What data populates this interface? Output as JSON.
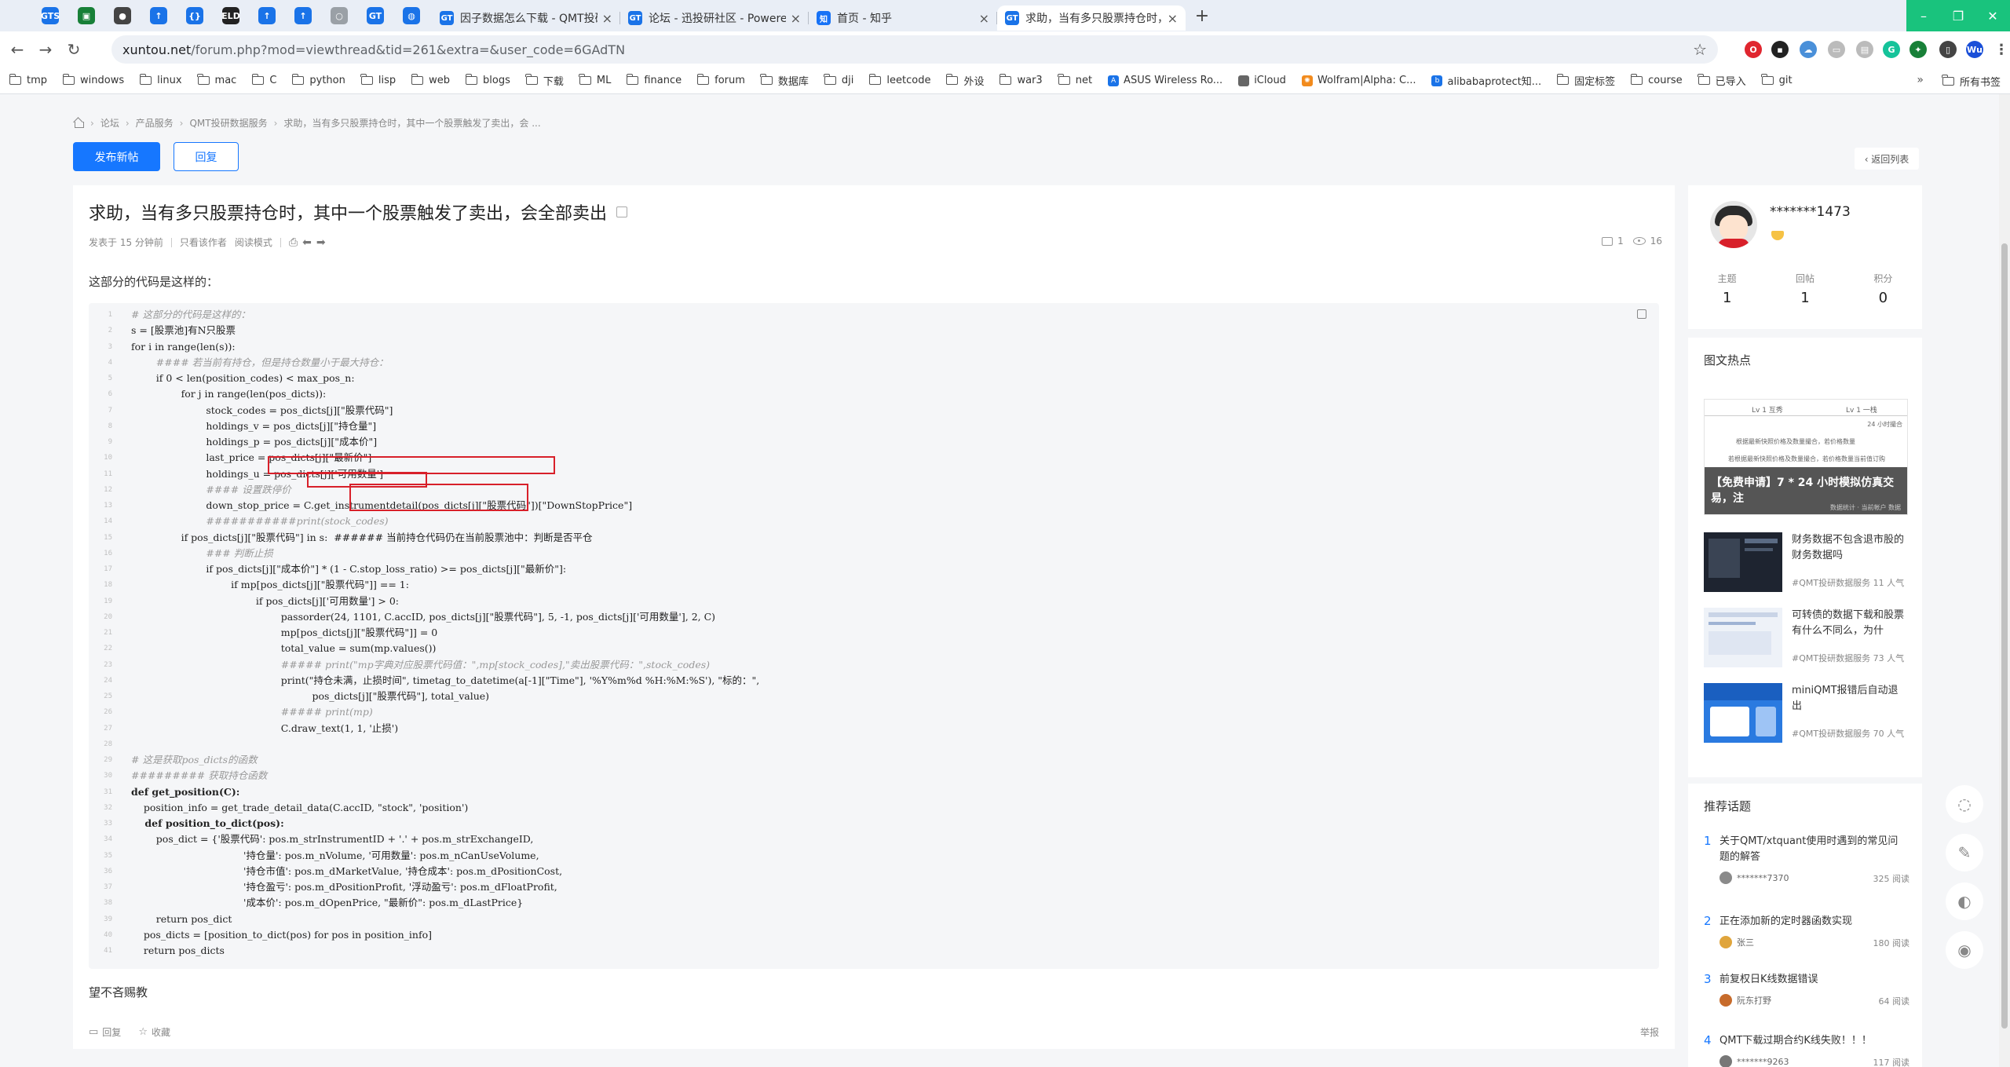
{
  "browser": {
    "pinned_tabs": [
      {
        "icon": "gstatic-icon",
        "label": "GTS",
        "color": "#1a73e8"
      },
      {
        "icon": "image-icon",
        "label": "▣",
        "color": "#188038"
      },
      {
        "icon": "github-icon",
        "label": "●",
        "color": "#444444"
      },
      {
        "icon": "arrow-up-icon",
        "label": "↑",
        "color": "#1a73e8"
      },
      {
        "icon": "bracket-icon",
        "label": "{}",
        "color": "#1a73e8"
      },
      {
        "icon": "eld-icon",
        "label": "ELD",
        "color": "#222222"
      },
      {
        "icon": "arrow-up-icon",
        "label": "↑",
        "color": "#1a73e8"
      },
      {
        "icon": "arrow-up-icon",
        "label": "↑",
        "color": "#1a73e8"
      },
      {
        "icon": "loading-icon",
        "label": "○",
        "color": "#9aa0a6"
      },
      {
        "icon": "gt-icon",
        "label": "GT",
        "color": "#1a73e8"
      },
      {
        "icon": "chat-icon",
        "label": "◍",
        "color": "#1a73e8"
      }
    ],
    "tabs": [
      {
        "title": "因子数据怎么下载 - QMT投研",
        "fav": "GT",
        "fav_color": "#1a73e8",
        "close": "×"
      },
      {
        "title": "论坛 - 迅投研社区 - Powered",
        "fav": "GT",
        "fav_color": "#1a73e8",
        "close": "×"
      },
      {
        "title": "首页 - 知乎",
        "fav": "知",
        "fav_color": "#1772f6",
        "close": "×"
      },
      {
        "title": "求助，当有多只股票持仓时，其",
        "fav": "GT",
        "fav_color": "#1a73e8",
        "close": "×"
      }
    ],
    "new_tab": "+",
    "window_controls": [
      "–",
      "❐",
      "✕"
    ],
    "nav": {
      "back": "←",
      "forward": "→",
      "reload": "↻"
    },
    "url_host": "xuntou.net",
    "url_path": "/forum.php?mod=viewthread&tid=261&extra=&user_code=6GAdTN",
    "star": "☆",
    "extensions": [
      {
        "icon": "opera-icon",
        "label": "O",
        "color": "#e0262f"
      },
      {
        "icon": "ext-icon",
        "label": "▪",
        "color": "#222222"
      },
      {
        "icon": "cloud-icon",
        "label": "☁",
        "color": "#4a90d9"
      },
      {
        "icon": "screen-icon",
        "label": "▭",
        "color": "#bbbbbb"
      },
      {
        "icon": "reader-icon",
        "label": "▤",
        "color": "#bbbbbb"
      },
      {
        "icon": "grammarly-icon",
        "label": "G",
        "color": "#15c39a"
      },
      {
        "icon": "puzzle-icon",
        "label": "✦",
        "color": "#188038"
      },
      {
        "icon": "sidepanel-icon",
        "label": "▯",
        "color": "#444444"
      },
      {
        "icon": "profile-icon",
        "label": "Wu",
        "color": "#1a4fd8"
      },
      {
        "icon": "menu-icon",
        "label": "⋮",
        "color": "#555555"
      }
    ],
    "bookmarks": [
      {
        "label": "tmp",
        "type": "folder"
      },
      {
        "label": "windows",
        "type": "folder"
      },
      {
        "label": "linux",
        "type": "folder"
      },
      {
        "label": "mac",
        "type": "folder"
      },
      {
        "label": "C",
        "type": "folder"
      },
      {
        "label": "python",
        "type": "folder"
      },
      {
        "label": "lisp",
        "type": "folder"
      },
      {
        "label": "web",
        "type": "folder"
      },
      {
        "label": "blogs",
        "type": "folder"
      },
      {
        "label": "下载",
        "type": "folder"
      },
      {
        "label": "ML",
        "type": "folder"
      },
      {
        "label": "finance",
        "type": "folder"
      },
      {
        "label": "forum",
        "type": "folder"
      },
      {
        "label": "数据库",
        "type": "folder"
      },
      {
        "label": "dji",
        "type": "folder"
      },
      {
        "label": "leetcode",
        "type": "folder"
      },
      {
        "label": "外设",
        "type": "folder"
      },
      {
        "label": "war3",
        "type": "folder"
      },
      {
        "label": "net",
        "type": "folder"
      },
      {
        "label": "ASUS Wireless Ro...",
        "type": "site",
        "fav": "A",
        "color": "#1a73e8"
      },
      {
        "label": "iCloud",
        "type": "site",
        "fav": "",
        "color": "#666666"
      },
      {
        "label": "Wolfram|Alpha: C...",
        "type": "site",
        "fav": "✺",
        "color": "#f28b1d"
      },
      {
        "label": "alibabaprotect知...",
        "type": "site",
        "fav": "b",
        "color": "#1a73e8"
      },
      {
        "label": "固定标签",
        "type": "folder"
      },
      {
        "label": "course",
        "type": "folder"
      },
      {
        "label": "已导入",
        "type": "folder"
      },
      {
        "label": "git",
        "type": "folder"
      }
    ],
    "bookmarks_more": "»",
    "all_bookmarks": "所有书签"
  },
  "page": {
    "breadcrumb": [
      "论坛",
      "产品服务",
      "QMT投研数据服务",
      "求助，当有多只股票持仓时，其中一个股票触发了卖出，会 ..."
    ],
    "breadcrumb_sep": "›",
    "new_post_label": "发布新帖",
    "reply_label": "回复",
    "back_list_label": "‹ 返回列表",
    "post": {
      "title": "求助，当有多只股票持仓时，其中一个股票触发了卖出，会全部卖出",
      "posted": "发表于 15 分钟前",
      "author_only": "只看该作者",
      "read_mode": "阅读模式",
      "comments": "1",
      "views": "16",
      "intro": "这部分的代码是这样的：",
      "outro": "望不吝赐教",
      "footer_reply": "回复",
      "footer_fav": "收藏",
      "report": "举报",
      "code": [
        {
          "n": "1",
          "t": "# 这部分的代码是这样的：",
          "c": "cm"
        },
        {
          "n": "2",
          "t": "s = [股票池]有N只股票",
          "c": ""
        },
        {
          "n": "3",
          "t": "for i in range(len(s)):",
          "c": ""
        },
        {
          "n": "4",
          "t": "        #### 若当前有持仓，但是持仓数量小于最大持仓：",
          "c": "cm"
        },
        {
          "n": "5",
          "t": "        if 0 < len(position_codes) < max_pos_n:",
          "c": ""
        },
        {
          "n": "6",
          "t": "                for j in range(len(pos_dicts)):",
          "c": ""
        },
        {
          "n": "7",
          "t": "                        stock_codes = pos_dicts[j][\"股票代码\"]",
          "c": ""
        },
        {
          "n": "8",
          "t": "                        holdings_v = pos_dicts[j][\"持仓量\"]",
          "c": ""
        },
        {
          "n": "9",
          "t": "                        holdings_p = pos_dicts[j][\"成本价\"]",
          "c": ""
        },
        {
          "n": "10",
          "t": "                        last_price = pos_dicts[j][\"最新价\"]",
          "c": ""
        },
        {
          "n": "11",
          "t": "                        holdings_u = pos_dicts[j]['可用数量']",
          "c": ""
        },
        {
          "n": "12",
          "t": "                        #### 设置跌停价",
          "c": "cm"
        },
        {
          "n": "13",
          "t": "                        down_stop_price = C.get_instrumentdetail(pos_dicts[j][\"股票代码\"])[\"DownStopPrice\"]",
          "c": ""
        },
        {
          "n": "14",
          "t": "                        ###########print(stock_codes)",
          "c": "cm"
        },
        {
          "n": "15",
          "t": "                if pos_dicts[j][\"股票代码\"] in s:  ###### 当前持仓代码仍在当前股票池中：判断是否平仓",
          "c": ""
        },
        {
          "n": "16",
          "t": "                        ### 判断止损",
          "c": "cm"
        },
        {
          "n": "17",
          "t": "                        if pos_dicts[j][\"成本价\"] * (1 - C.stop_loss_ratio) >= pos_dicts[j][\"最新价\"]:",
          "c": ""
        },
        {
          "n": "18",
          "t": "                                if mp[pos_dicts[j][\"股票代码\"]] == 1:",
          "c": ""
        },
        {
          "n": "19",
          "t": "                                        if pos_dicts[j]['可用数量'] > 0:",
          "c": ""
        },
        {
          "n": "20",
          "t": "                                                passorder(24, 1101, C.accID, pos_dicts[j][\"股票代码\"], 5, -1, pos_dicts[j]['可用数量'], 2, C)",
          "c": ""
        },
        {
          "n": "21",
          "t": "                                                mp[pos_dicts[j][\"股票代码\"]] = 0",
          "c": ""
        },
        {
          "n": "22",
          "t": "                                                total_value = sum(mp.values())",
          "c": ""
        },
        {
          "n": "23",
          "t": "                                                ##### print(\"mp字典对应股票代码值：\",mp[stock_codes],\"卖出股票代码：\",stock_codes)",
          "c": "cm"
        },
        {
          "n": "24",
          "t": "                                                print(\"持仓未满，止损时间\", timetag_to_datetime(a[-1][\"Time\"], '%Y%m%d %H:%M:%S'), \"标的：\",",
          "c": ""
        },
        {
          "n": "25",
          "t": "                                                          pos_dicts[j][\"股票代码\"], total_value)",
          "c": ""
        },
        {
          "n": "26",
          "t": "                                                ##### print(mp)",
          "c": "cm"
        },
        {
          "n": "27",
          "t": "                                                C.draw_text(1, 1, '止损')",
          "c": ""
        },
        {
          "n": "28",
          "t": "",
          "c": ""
        },
        {
          "n": "29",
          "t": "# 这是获取pos_dicts的函数",
          "c": "cm"
        },
        {
          "n": "30",
          "t": "######### 获取持仓函数",
          "c": "cm"
        },
        {
          "n": "31",
          "t": "def get_position(C):",
          "c": "kw"
        },
        {
          "n": "32",
          "t": "    position_info = get_trade_detail_data(C.accID, \"stock\", 'position')",
          "c": ""
        },
        {
          "n": "33",
          "t": "    def position_to_dict(pos):",
          "c": "kw"
        },
        {
          "n": "34",
          "t": "        pos_dict = {'股票代码': pos.m_strInstrumentID + '.' + pos.m_strExchangeID,",
          "c": ""
        },
        {
          "n": "35",
          "t": "                                    '持仓量': pos.m_nVolume, '可用数量': pos.m_nCanUseVolume,",
          "c": ""
        },
        {
          "n": "36",
          "t": "                                    '持仓市值': pos.m_dMarketValue, '持仓成本': pos.m_dPositionCost,",
          "c": ""
        },
        {
          "n": "37",
          "t": "                                    '持仓盈亏': pos.m_dPositionProfit, '浮动盈亏': pos.m_dFloatProfit,",
          "c": ""
        },
        {
          "n": "38",
          "t": "                                    '成本价': pos.m_dOpenPrice, \"最新价\": pos.m_dLastPrice}",
          "c": ""
        },
        {
          "n": "39",
          "t": "        return pos_dict",
          "c": ""
        },
        {
          "n": "40",
          "t": "    pos_dicts = [position_to_dict(pos) for pos in position_info]",
          "c": ""
        },
        {
          "n": "41",
          "t": "    return pos_dicts",
          "c": ""
        }
      ]
    }
  },
  "sidebar": {
    "author": {
      "name": "*******1473",
      "stats": [
        {
          "label": "主题",
          "value": "1"
        },
        {
          "label": "回帖",
          "value": "1"
        },
        {
          "label": "积分",
          "value": "0"
        }
      ]
    },
    "hot": {
      "title": "图文热点",
      "banner": {
        "col1": "Lv 1 互秀",
        "col2": "Lv 1 一栈",
        "row2": "24 小时撮合",
        "row3": "根据最新快照价格及数量撮合，若价格数量",
        "row4": "若根据最新快照价格及数量撮合，若价格数量当前值订购",
        "title": "【免费申请】7 * 24 小时模拟仿真交易，注",
        "sub": "数据统计 · 当前帐户 数据"
      },
      "items": [
        {
          "title": "财务数据不包含退市股的财务数据吗",
          "meta": "#QMT投研数据服务 11 人气",
          "thumb": "dark"
        },
        {
          "title": "可转债的数据下载和股票有什么不同么，为什",
          "meta": "#QMT投研数据服务 73 人气",
          "thumb": "light"
        },
        {
          "title": "miniQMT报错后自动退出",
          "meta": "#QMT投研数据服务 70 人气",
          "thumb": "blue"
        }
      ]
    },
    "topics": {
      "title": "推荐话题",
      "items": [
        {
          "num": "1",
          "title": "关于QMT/xtquant使用时遇到的常见问题的解答",
          "author": "*******7370",
          "reads": "325 阅读"
        },
        {
          "num": "2",
          "title": "正在添加新的定时器函数实现",
          "author": "张三",
          "reads": "180 阅读"
        },
        {
          "num": "3",
          "title": "前复权日K线数据错误",
          "author": "阮东打野",
          "reads": "64 阅读"
        },
        {
          "num": "4",
          "title": "QMT下载过期合约K线失败！！！",
          "author": "*******9263",
          "reads": "117 阅读"
        }
      ]
    }
  },
  "float_tools": [
    {
      "icon": "bulb-icon",
      "label": "◌"
    },
    {
      "icon": "edit-icon",
      "label": "✎"
    },
    {
      "icon": "wechat-icon",
      "label": "◐"
    },
    {
      "icon": "qq-icon",
      "label": "◉"
    }
  ]
}
